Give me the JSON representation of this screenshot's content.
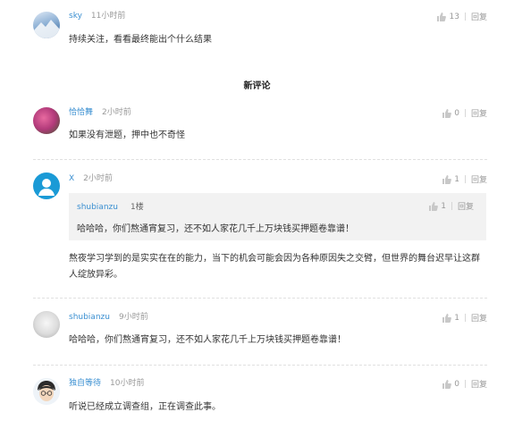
{
  "comments_top": {
    "user": "sky",
    "time": "11小时前",
    "likes": "13",
    "reply": "回复",
    "text": "持续关注，看看最终能出个什么结果"
  },
  "section": {
    "title": "新评论"
  },
  "c1": {
    "user": "恰恰舞",
    "time": "2小时前",
    "likes": "0",
    "reply": "回复",
    "text": "如果没有泄题，押中也不奇怪"
  },
  "c2": {
    "user": "X",
    "time": "2小时前",
    "likes": "1",
    "reply": "回复",
    "quote": {
      "user": "shubianzu",
      "floor": "1楼",
      "likes": "1",
      "reply": "回复",
      "text": "哈哈哈，你们熬通宵复习，还不如人家花几千上万块钱买押题卷靠谱！"
    },
    "text": "熬夜学习学到的是实实在在的能力，当下的机会可能会因为各种原因失之交臂，但世界的舞台迟早让这群人绽放异彩。"
  },
  "c3": {
    "user": "shubianzu",
    "time": "9小时前",
    "likes": "1",
    "reply": "回复",
    "text": "哈哈哈，你们熬通宵复习，还不如人家花几千上万块钱买押题卷靠谱！"
  },
  "c4": {
    "user": "独自等待",
    "time": "10小时前",
    "likes": "0",
    "reply": "回复",
    "text": "听说已经成立调查组，正在调查此事。"
  },
  "icons": {
    "like": "thumbs-up-icon"
  },
  "colors": {
    "username": "#3a8fd1",
    "muted": "#999999",
    "quote_bg": "#f2f2f2"
  }
}
